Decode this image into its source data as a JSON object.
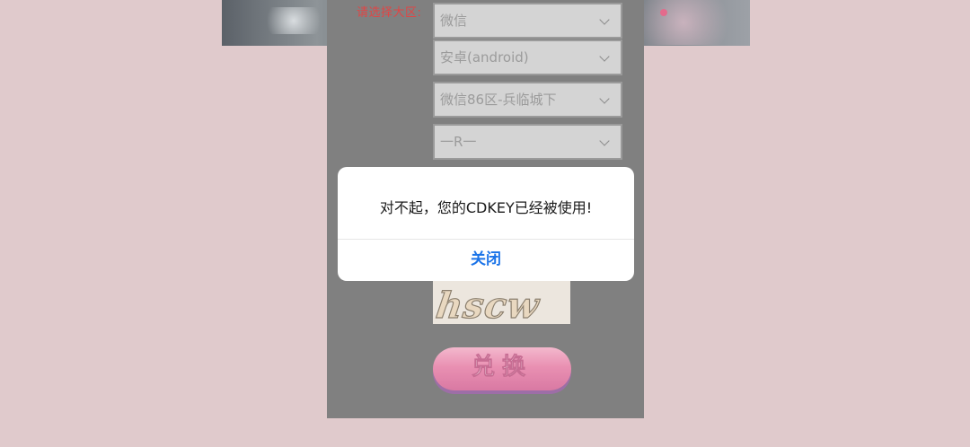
{
  "banner": {
    "description_free": true
  },
  "form": {
    "area_label": "请选择大区:",
    "selects": [
      {
        "value": "微信"
      },
      {
        "value": "安卓(android)"
      },
      {
        "value": "微信86区-兵临城下"
      },
      {
        "value": "一R一"
      }
    ],
    "captcha_text": "hscw",
    "redeem_label": "兑换"
  },
  "dialog": {
    "message": "对不起，您的CDKEY已经被使用!",
    "close_label": "关闭"
  },
  "colors": {
    "page_bg": "#e0cacc",
    "panel_bg": "#808080",
    "label_red": "#e04545",
    "dialog_button_blue": "#1a73e8"
  }
}
